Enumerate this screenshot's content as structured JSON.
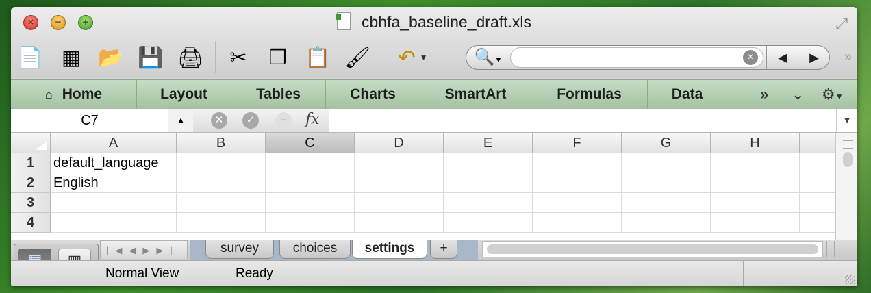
{
  "window": {
    "title": "cbhfa_baseline_draft.xls"
  },
  "toolbar": {
    "items": [
      {
        "name": "new-icon",
        "glyph": "📄"
      },
      {
        "name": "templates-icon",
        "glyph": "▦"
      },
      {
        "name": "open-icon",
        "glyph": "📂"
      },
      {
        "name": "save-icon",
        "glyph": "💾"
      },
      {
        "name": "print-icon",
        "glyph": "🖨"
      },
      {
        "name": "cut-icon",
        "glyph": "✂"
      },
      {
        "name": "copy-icon",
        "glyph": "❐"
      },
      {
        "name": "paste-icon",
        "glyph": "📋"
      },
      {
        "name": "format-painter-icon",
        "glyph": "🖌"
      },
      {
        "name": "undo-icon",
        "glyph": "↶"
      }
    ],
    "search_placeholder": "",
    "back_glyph": "◀",
    "forward_glyph": "▶",
    "overflow_glyph": "»"
  },
  "ribbon": {
    "tabs": [
      "Home",
      "Layout",
      "Tables",
      "Charts",
      "SmartArt",
      "Formulas",
      "Data"
    ],
    "more_glyph": "»",
    "collapse_glyph": "⌄",
    "settings_glyph": "⚙"
  },
  "formula_bar": {
    "cell_ref": "C7",
    "fx_label": "fx",
    "formula": ""
  },
  "grid": {
    "columns": [
      "A",
      "B",
      "C",
      "D",
      "E",
      "F",
      "G",
      "H"
    ],
    "selected_column": "C",
    "rows": [
      {
        "num": "1",
        "cells": [
          "default_language",
          "",
          "",
          "",
          "",
          "",
          "",
          ""
        ]
      },
      {
        "num": "2",
        "cells": [
          "English",
          "",
          "",
          "",
          "",
          "",
          "",
          ""
        ]
      },
      {
        "num": "3",
        "cells": [
          "",
          "",
          "",
          "",
          "",
          "",
          "",
          ""
        ]
      },
      {
        "num": "4",
        "cells": [
          "",
          "",
          "",
          "",
          "",
          "",
          "",
          ""
        ]
      }
    ]
  },
  "sheets": {
    "tabs": [
      "survey",
      "choices",
      "settings"
    ],
    "active": "settings",
    "add_label": "+"
  },
  "status": {
    "view": "Normal View",
    "state": "Ready"
  }
}
